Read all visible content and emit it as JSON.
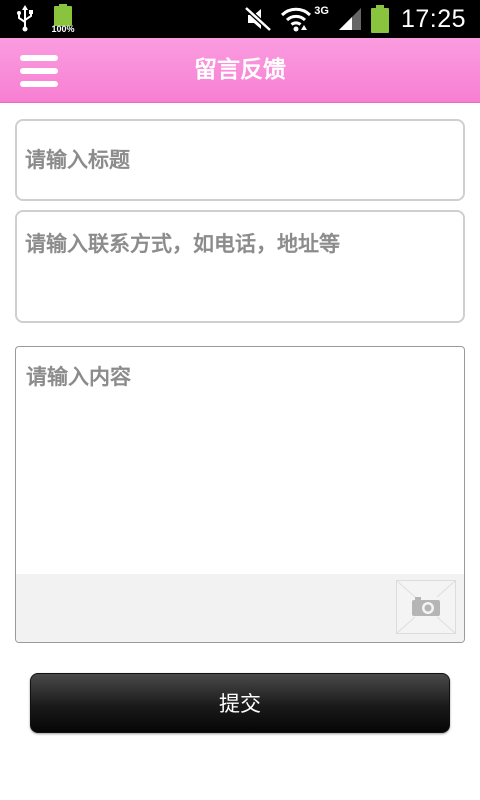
{
  "status_bar": {
    "battery_percent": "100%",
    "network": "3G",
    "time": "17:25",
    "icons": [
      "usb-icon",
      "battery-small-icon",
      "mute-icon",
      "wifi-icon",
      "signal-icon",
      "battery-icon"
    ]
  },
  "header": {
    "title": "留言反馈",
    "background_color": "#f98ad8",
    "menu_icon": "hamburger-menu-icon"
  },
  "form": {
    "title_placeholder": "请输入标题",
    "contact_placeholder": "请输入联系方式，如电话，地址等",
    "content_placeholder": "请输入内容",
    "attach_icon": "camera-icon",
    "submit_label": "提交"
  }
}
